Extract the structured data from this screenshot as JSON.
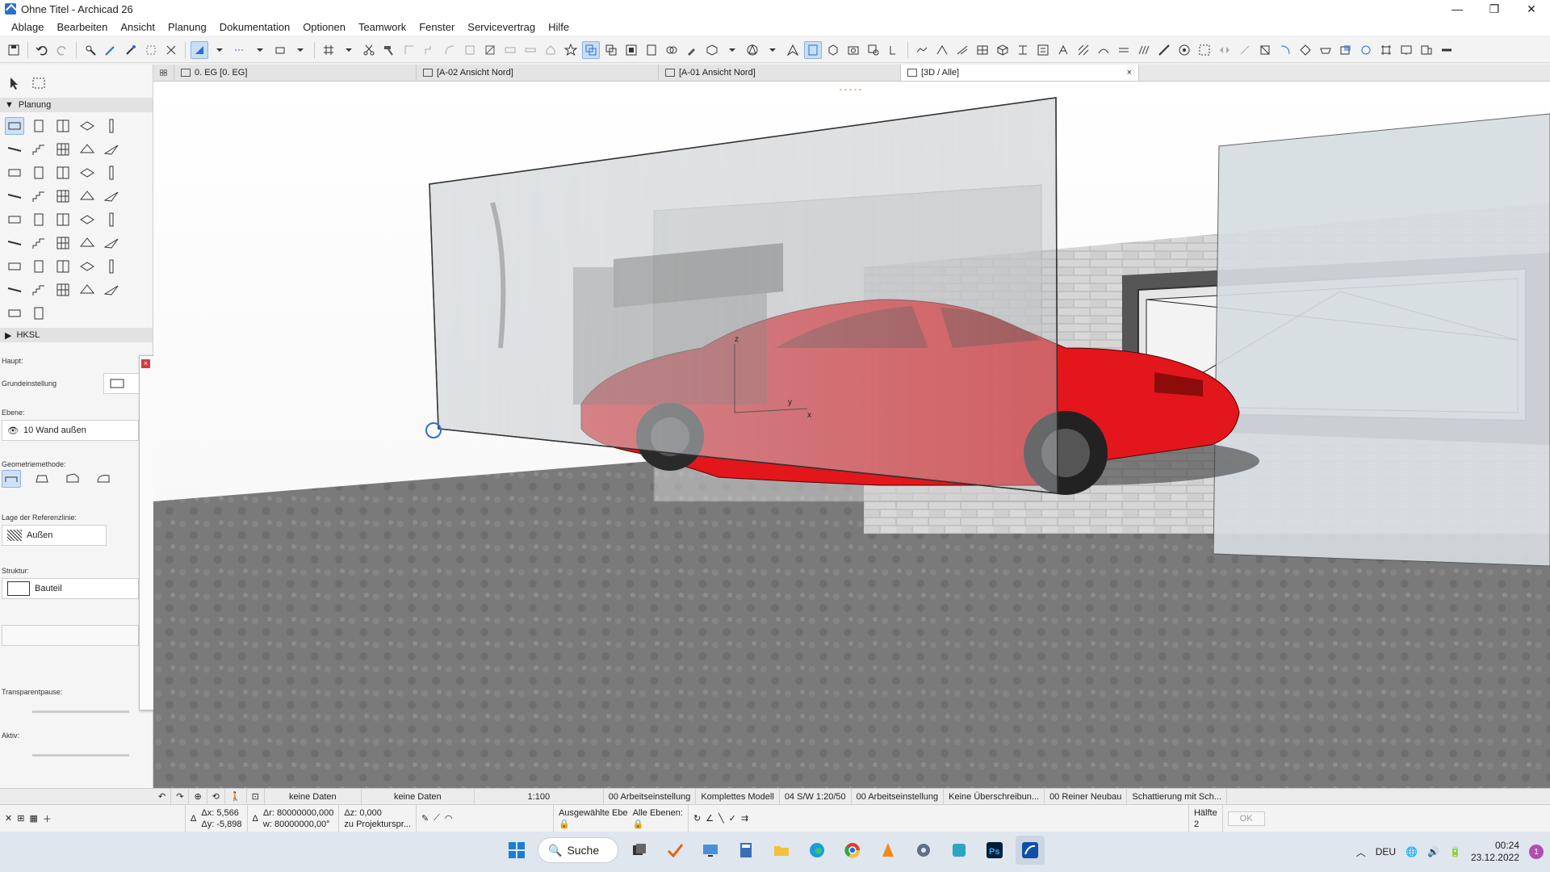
{
  "window": {
    "title": "Ohne Titel - Archicad 26",
    "minimize": "—",
    "maximize": "❐",
    "close": "✕"
  },
  "menu": [
    "Ablage",
    "Bearbeiten",
    "Ansicht",
    "Planung",
    "Dokumentation",
    "Optionen",
    "Teamwork",
    "Fenster",
    "Servicevertrag",
    "Hilfe"
  ],
  "tabs": [
    {
      "label": "0. EG [0. EG]",
      "active": false
    },
    {
      "label": "[A-02 Ansicht Nord]",
      "active": false
    },
    {
      "label": "[A-01 Ansicht Nord]",
      "active": false
    },
    {
      "label": "[3D / Alle]",
      "active": true
    }
  ],
  "tab_close": "×",
  "toolbox": {
    "section_planung": "Planung",
    "section_hksl": "HKSL"
  },
  "infobox": {
    "haupt": "Haupt:",
    "grundeinstellung": "Grundeinstellung",
    "ebene_label": "Ebene:",
    "ebene_value": "10 Wand außen",
    "geometrie_label": "Geometriemethode:",
    "referenz_label": "Lage der Referenzlinie:",
    "referenz_value": "Außen",
    "struktur_label": "Struktur:",
    "struktur_value": "Bauteil",
    "transparent_label": "Transparentpause:",
    "aktiv_label": "Aktiv:"
  },
  "statusbar": {
    "data1": "keine Daten",
    "data2": "keine Daten",
    "scale": "1:100",
    "layer_set": "00 Arbeitseinstellung",
    "model": "Komplettes Modell",
    "pen_set": "04 S/W 1:20/50",
    "mvo": "00 Arbeitseinstellung",
    "override": "Keine Überschreibun...",
    "renovation": "00 Reiner Neubau",
    "shading": "Schattierung mit Sch..."
  },
  "coordbar": {
    "dx_label": "Δx:",
    "dx": "5,566",
    "dy_label": "Δy:",
    "dy": "-5,898",
    "dr_label": "Δr:",
    "dr": "80000000,000",
    "w_label": "w:",
    "w": "80000000,00°",
    "dz_label": "Δz:",
    "dz": "0,000",
    "zu_proj": "zu Projekturspr...",
    "ausgewaehlte": "Ausgewählte Ebe",
    "alle_ebenen": "Alle Ebenen:",
    "haelfte": "Hälfte",
    "haelfte_num": "2",
    "ok": "OK"
  },
  "taskbar": {
    "search": "Suche",
    "lang": "DEU",
    "time": "00:24",
    "date": "23.12.2022",
    "notif": "1"
  },
  "colors": {
    "accent": "#2a6fd6",
    "car_red": "#e3161b",
    "brick": "#c9c9c9"
  }
}
